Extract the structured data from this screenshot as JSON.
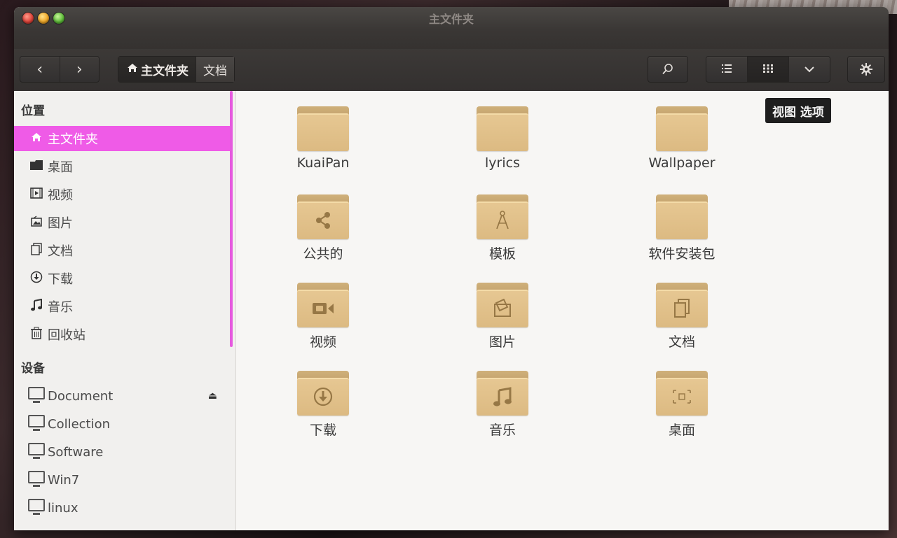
{
  "window": {
    "title": "主文件夹"
  },
  "toolbar": {
    "back_glyph": "‹",
    "forward_glyph": "›",
    "home_crumb": "主文件夹",
    "docs_crumb": "文档",
    "search_icon": "search-icon",
    "list_view_icon": "list-view-icon",
    "icon_view_icon": "icon-view-icon",
    "view_menu_icon": "chevron-down-icon",
    "settings_icon": "gear-icon"
  },
  "tooltip": {
    "text": "视图 选项"
  },
  "sidebar": {
    "places_heading": "位置",
    "places": [
      {
        "label": "主文件夹",
        "icon": "home-icon",
        "selected": true
      },
      {
        "label": "桌面",
        "icon": "desktop-folder-icon"
      },
      {
        "label": "视频",
        "icon": "video-icon"
      },
      {
        "label": "图片",
        "icon": "picture-icon"
      },
      {
        "label": "文档",
        "icon": "document-icon"
      },
      {
        "label": "下载",
        "icon": "download-icon"
      },
      {
        "label": "音乐",
        "icon": "music-icon"
      },
      {
        "label": "回收站",
        "icon": "trash-icon"
      }
    ],
    "devices_heading": "设备",
    "devices": [
      {
        "label": "Document",
        "icon": "drive-icon",
        "eject": true
      },
      {
        "label": "Collection",
        "icon": "drive-icon"
      },
      {
        "label": "Software",
        "icon": "drive-icon"
      },
      {
        "label": "Win7",
        "icon": "drive-icon"
      },
      {
        "label": "linux",
        "icon": "drive-icon"
      }
    ]
  },
  "files": [
    {
      "label": "KuaiPan",
      "icon": "folder-icon"
    },
    {
      "label": "lyrics",
      "icon": "folder-icon"
    },
    {
      "label": "Wallpaper",
      "icon": "folder-icon"
    },
    {
      "label": "公共的",
      "icon": "share-folder-icon"
    },
    {
      "label": "模板",
      "icon": "template-folder-icon"
    },
    {
      "label": "软件安装包",
      "icon": "folder-icon"
    },
    {
      "label": "视频",
      "icon": "video-folder-icon"
    },
    {
      "label": "图片",
      "icon": "picture-folder-icon"
    },
    {
      "label": "文档",
      "icon": "document-folder-icon"
    },
    {
      "label": "下载",
      "icon": "download-folder-icon"
    },
    {
      "label": "音乐",
      "icon": "music-folder-icon"
    },
    {
      "label": "桌面",
      "icon": "desktop-folder-icon"
    }
  ],
  "colors": {
    "accent": "#ef5be7",
    "folder": "#dcba82",
    "titlebar": "#3a3735"
  }
}
